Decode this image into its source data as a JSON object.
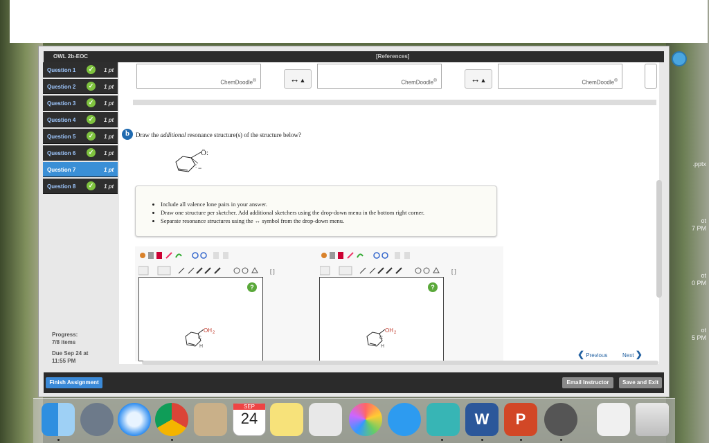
{
  "owl": {
    "title": "OWL 2b-EOC",
    "references": "[References]"
  },
  "sidebar": {
    "questions": [
      {
        "label": "Question 1",
        "points": "1 pt",
        "check": "✓"
      },
      {
        "label": "Question 2",
        "points": "1 pt",
        "check": "✓"
      },
      {
        "label": "Question 3",
        "points": "1 pt",
        "check": "✓"
      },
      {
        "label": "Question 4",
        "points": "1 pt",
        "check": "✓"
      },
      {
        "label": "Question 5",
        "points": "1 pt",
        "check": "✓"
      },
      {
        "label": "Question 6",
        "points": "1 pt",
        "check": "✓"
      },
      {
        "label": "Question 7",
        "points": "1 pt",
        "check": ""
      },
      {
        "label": "Question 8",
        "points": "1 pt",
        "check": "✓"
      }
    ],
    "progress_label": "Progress:",
    "progress_value": "7/8 items",
    "due_line1": "Due Sep 24 at",
    "due_line2": "11:55 PM"
  },
  "sketchers_top": {
    "label": "ChemDoodle",
    "reg": "®"
  },
  "part": {
    "letter": "b",
    "prompt_pre": "Draw the ",
    "prompt_em": "additional",
    "prompt_post": " resonance structure(s) of the structure below?"
  },
  "instructions": [
    "Include all valence lone pairs in your answer.",
    "Draw one structure per sketcher. Add additional sketchers using the drop-down menu in the bottom right corner.",
    "Separate resonance structures using the ↔ symbol from the drop-down menu."
  ],
  "sketch": {
    "help": "?",
    "atom": "OH",
    "sub": "2",
    "h": "H",
    "c": "C"
  },
  "nav": {
    "previous": "Previous",
    "next": "Next"
  },
  "buttons": {
    "finish": "Finish Assignment",
    "email": "Email Instructor",
    "save_exit": "Save and Exit"
  },
  "desktop_labels": {
    "a": ".pptx",
    "b1": "ot",
    "b2": "7 PM",
    "c1": "ot",
    "c2": "0 PM",
    "d1": "ot",
    "d2": "5 PM"
  },
  "dock": {
    "calendar_month": "SEP",
    "calendar_day": "24",
    "word": "W",
    "ppt": "P"
  }
}
